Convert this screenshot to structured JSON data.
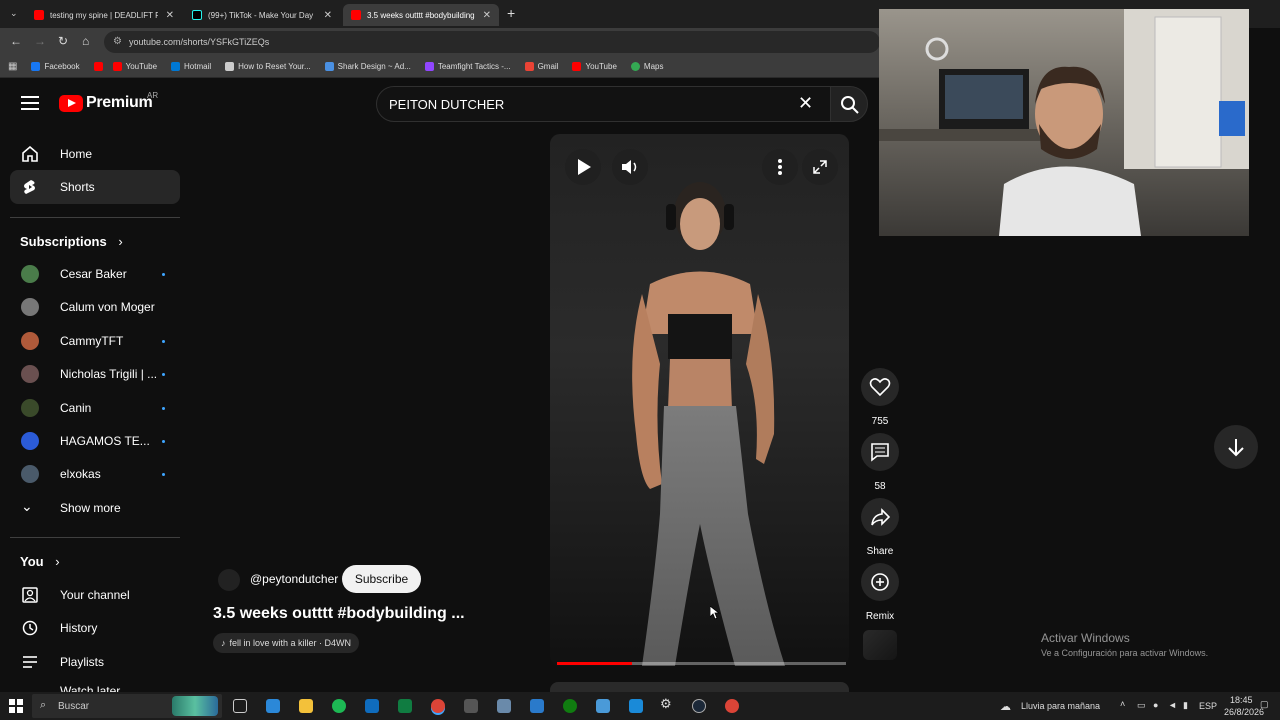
{
  "browser": {
    "tabs": [
      {
        "title": "testing my spine | DEADLIFT PR",
        "color": "#ff0000"
      },
      {
        "title": "(99+) TikTok - Make Your Day",
        "color": "#111111"
      },
      {
        "title": "3.5 weeks outttt #bodybuilding",
        "color": "#ff0000",
        "active": true
      }
    ],
    "url": "youtube.com/shorts/YSFkGTiZEQs",
    "bookmarks": [
      {
        "label": "Facebook",
        "color": "#1877f2"
      },
      {
        "label": "",
        "color": "#ff0000"
      },
      {
        "label": "YouTube",
        "color": "#ff0000"
      },
      {
        "label": "Hotmail",
        "color": "#0078d4"
      },
      {
        "label": "How to Reset Your...",
        "color": "#cccccc"
      },
      {
        "label": "Shark Design ~ Ad...",
        "color": "#4a90e2"
      },
      {
        "label": "Teamfight Tactics -...",
        "color": "#9146ff"
      },
      {
        "label": "Gmail",
        "color": "#ea4335"
      },
      {
        "label": "YouTube",
        "color": "#ff0000"
      },
      {
        "label": "Maps",
        "color": "#34a853"
      }
    ]
  },
  "youtube": {
    "logo_text": "Premium",
    "country": "AR",
    "search_value": "PEITON DUTCHER",
    "nav": [
      {
        "label": "Home",
        "icon": "home-icon"
      },
      {
        "label": "Shorts",
        "icon": "shorts-icon",
        "selected": true
      }
    ],
    "subscriptions_title": "Subscriptions",
    "subscriptions": [
      {
        "name": "Cesar Baker",
        "color": "#4a7c4a",
        "dot": true
      },
      {
        "name": "Calum von Moger",
        "color": "#777777",
        "dot": false
      },
      {
        "name": "CammyTFT",
        "color": "#b05a3a",
        "dot": true
      },
      {
        "name": "Nicholas Trigili | ...",
        "color": "#6a5050",
        "dot": true
      },
      {
        "name": "Canin",
        "color": "#3a4a2a",
        "dot": true
      },
      {
        "name": "HAGAMOS TE...",
        "color": "#2b5bd7",
        "dot": true
      },
      {
        "name": "elxokas",
        "color": "#4a5a6a",
        "dot": true
      }
    ],
    "show_more": "Show more",
    "you_title": "You",
    "you_items": [
      {
        "label": "Your channel",
        "icon": "channel-icon"
      },
      {
        "label": "History",
        "icon": "history-icon"
      },
      {
        "label": "Playlists",
        "icon": "playlists-icon"
      },
      {
        "label": "Watch later",
        "icon": "watch-later-icon"
      }
    ],
    "short": {
      "channel": "@peytondutcher",
      "subscribe": "Subscribe",
      "title": "3.5 weeks outttt #bodybuilding ...",
      "sound": "fell in love with a killer · D4WN",
      "progress": 0.26
    },
    "actions": {
      "likes": "755",
      "comments": "58",
      "share": "Share",
      "remix": "Remix"
    }
  },
  "overlay": {
    "watermark_title": "Activar Windows",
    "watermark_sub": "Ve a Configuración para activar Windows."
  },
  "taskbar": {
    "search": "Buscar",
    "weather": "Lluvia para mañana",
    "lang": "ESP",
    "time": "18:45",
    "date": "26/8/2026"
  }
}
